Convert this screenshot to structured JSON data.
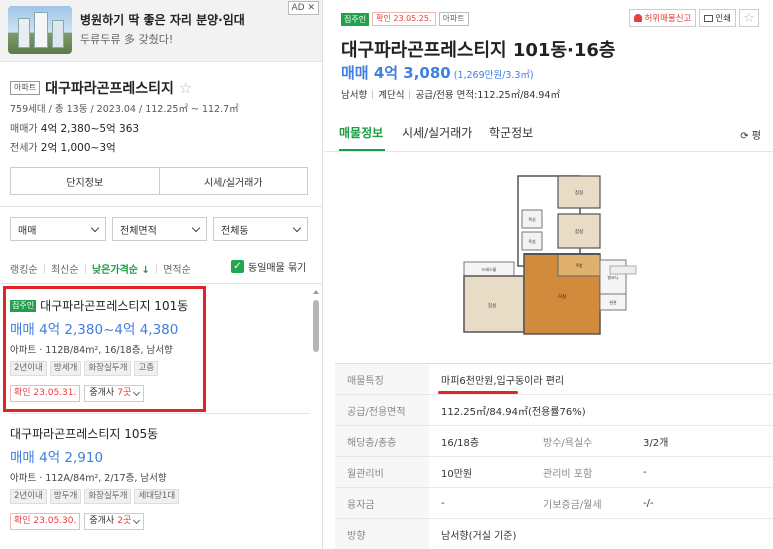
{
  "ad": {
    "title": "병원하기 딱 좋은 자리 분양·임대",
    "subtitle": "두류두류 多 갖췄다!",
    "badge": "AD ✕"
  },
  "complex": {
    "type_tag": "아파트",
    "name": "대구파라곤프레스티지",
    "star": "☆",
    "meta": "759세대 / 총 13동 / 2023.04 / 112.25㎡ ~ 112.7㎡",
    "sale_label": "매매가",
    "sale_value": "4억 2,380~5억 363",
    "jeonse_label": "전세가",
    "jeonse_value": "2억 1,000~3억",
    "btn_info": "단지정보",
    "btn_trades": "시세/실거래가"
  },
  "filters": {
    "deal": "매매",
    "area": "전체면적",
    "building": "전체동"
  },
  "sorts": {
    "rank": "랭킹순",
    "recent": "최신순",
    "low_price": "낮은가격순 ↓",
    "area": "면적순",
    "same_listing": "동일매물 묶기"
  },
  "listings": [
    {
      "tag": "집주인",
      "title": "대구파라곤프레스티지 101동",
      "price": "매매 4억 2,380~4억 4,380",
      "spec": "아파트 · 112B/84m², 16/18층, 남서향",
      "chips": [
        "2년이내",
        "방세개",
        "화장실두개",
        "고층"
      ],
      "confirm": "확인 23.05.31.",
      "agent_prefix": "중개사 ",
      "agent_count": "7곳"
    },
    {
      "title": "대구파라곤프레스티지 105동",
      "price": "매매 4억 2,910",
      "spec": "아파트 · 112A/84m², 2/17층, 남서향",
      "chips": [
        "2년이내",
        "방두개",
        "화장실두개",
        "세대당1대"
      ],
      "confirm": "확인 23.05.30.",
      "agent_prefix": "중개사 ",
      "agent_count": "2곳"
    }
  ],
  "detail": {
    "tag_owner": "집주인",
    "tag_confirm": "확인 23.05.25.",
    "tag_type": "아파트",
    "report": "허위매물신고",
    "print": "인쇄",
    "star": "☆",
    "title": "대구파라곤프레스티지 101동·16층",
    "price": "매매 4억 3,080",
    "price_per": "(1,269만원/3.3㎡)",
    "info_direction": "남서향",
    "info_stairs": "계단식",
    "info_area": "공급/전용 면적:112.25㎡/84.94㎡",
    "tabs": [
      "매물정보",
      "시세/실거래가",
      "학군정보"
    ],
    "refresh": "⟳ 평",
    "floorplan_labels": [
      "침실",
      "침실",
      "욕실",
      "욕실",
      "드레스룸",
      "거실",
      "주방",
      "침실",
      "발코니",
      "현관"
    ],
    "rows": [
      {
        "label": "매물특징",
        "value": "마피6천만원,입구동이라 편리"
      },
      {
        "label": "공급/전용면적",
        "value": "112.25㎡/84.94㎡(전용률76%)"
      },
      {
        "label": "해당층/총층",
        "value": "16/18층",
        "label2": "방수/욕실수",
        "value2": "3/2개"
      },
      {
        "label": "월관리비",
        "value": "10만원",
        "label2": "관리비 포함",
        "value2": "-"
      },
      {
        "label": "융자금",
        "value": "-",
        "label2": "기보증금/월세",
        "value2": "-/-"
      },
      {
        "label": "방향",
        "value": "남서향(거실 기준)"
      }
    ]
  }
}
